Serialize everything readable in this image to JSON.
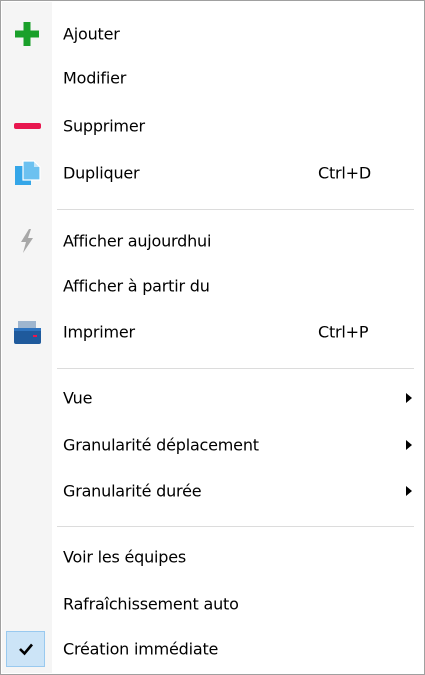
{
  "menu": {
    "items": [
      {
        "label": "Ajouter",
        "icon": "plus-icon"
      },
      {
        "label": "Modifier"
      },
      {
        "label": "Supprimer",
        "icon": "minus-icon"
      },
      {
        "label": "Dupliquer",
        "shortcut": "Ctrl+D",
        "icon": "copy-icon"
      },
      {
        "label": "Afficher aujourdhui",
        "icon": "lightning-icon"
      },
      {
        "label": "Afficher à partir du"
      },
      {
        "label": "Imprimer",
        "shortcut": "Ctrl+P",
        "icon": "printer-icon"
      },
      {
        "label": "Vue",
        "submenu": true
      },
      {
        "label": "Granularité déplacement",
        "submenu": true
      },
      {
        "label": "Granularité durée",
        "submenu": true
      },
      {
        "label": "Voir les équipes"
      },
      {
        "label": "Rafraîchissement auto"
      },
      {
        "label": "Création immédiate",
        "checked": true,
        "icon": "checkmark-icon"
      }
    ]
  },
  "colors": {
    "plus": "#1aa02a",
    "minus": "#e8174f",
    "copy": "#35a6e8",
    "printer": "#1f5a9c",
    "lightning": "#a8a8a8",
    "check_bg": "#cce4f7"
  }
}
